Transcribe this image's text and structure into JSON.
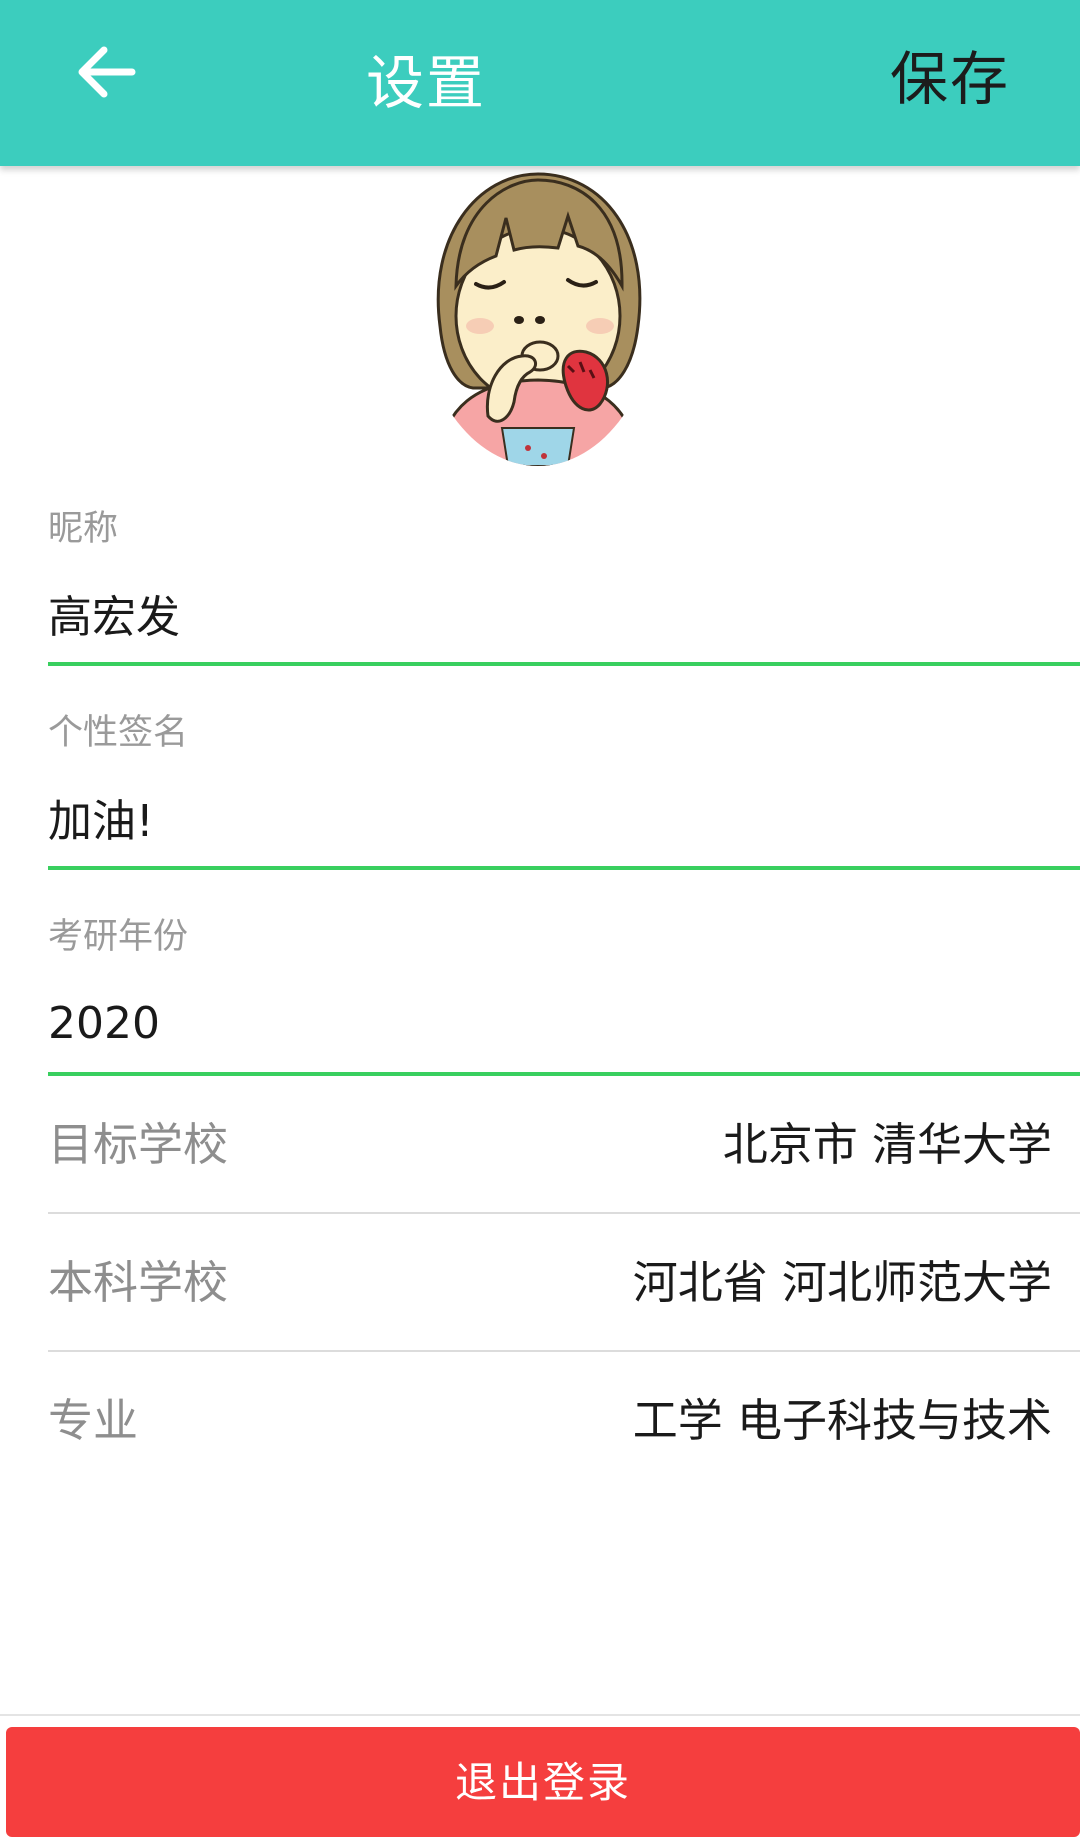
{
  "header": {
    "title": "设置",
    "save_label": "保存",
    "back_icon": "arrow-left-icon",
    "bg_color": "#3ccdbe"
  },
  "profile": {
    "avatar": "cartoon-girl-avatar"
  },
  "form": {
    "nickname": {
      "label": "昵称",
      "value": "高宏发"
    },
    "signature": {
      "label": "个性签名",
      "value": "加油!"
    },
    "exam_year": {
      "label": "考研年份",
      "value": "2020"
    },
    "underline_color": "#39cf5f"
  },
  "rows": [
    {
      "label": "目标学校",
      "value": "北京市 清华大学"
    },
    {
      "label": "本科学校",
      "value": "河北省 河北师范大学"
    },
    {
      "label": "专业",
      "value": "工学 电子科技与技术"
    }
  ],
  "footer": {
    "logout_label": "退出登录",
    "logout_color": "#f53e3e"
  }
}
